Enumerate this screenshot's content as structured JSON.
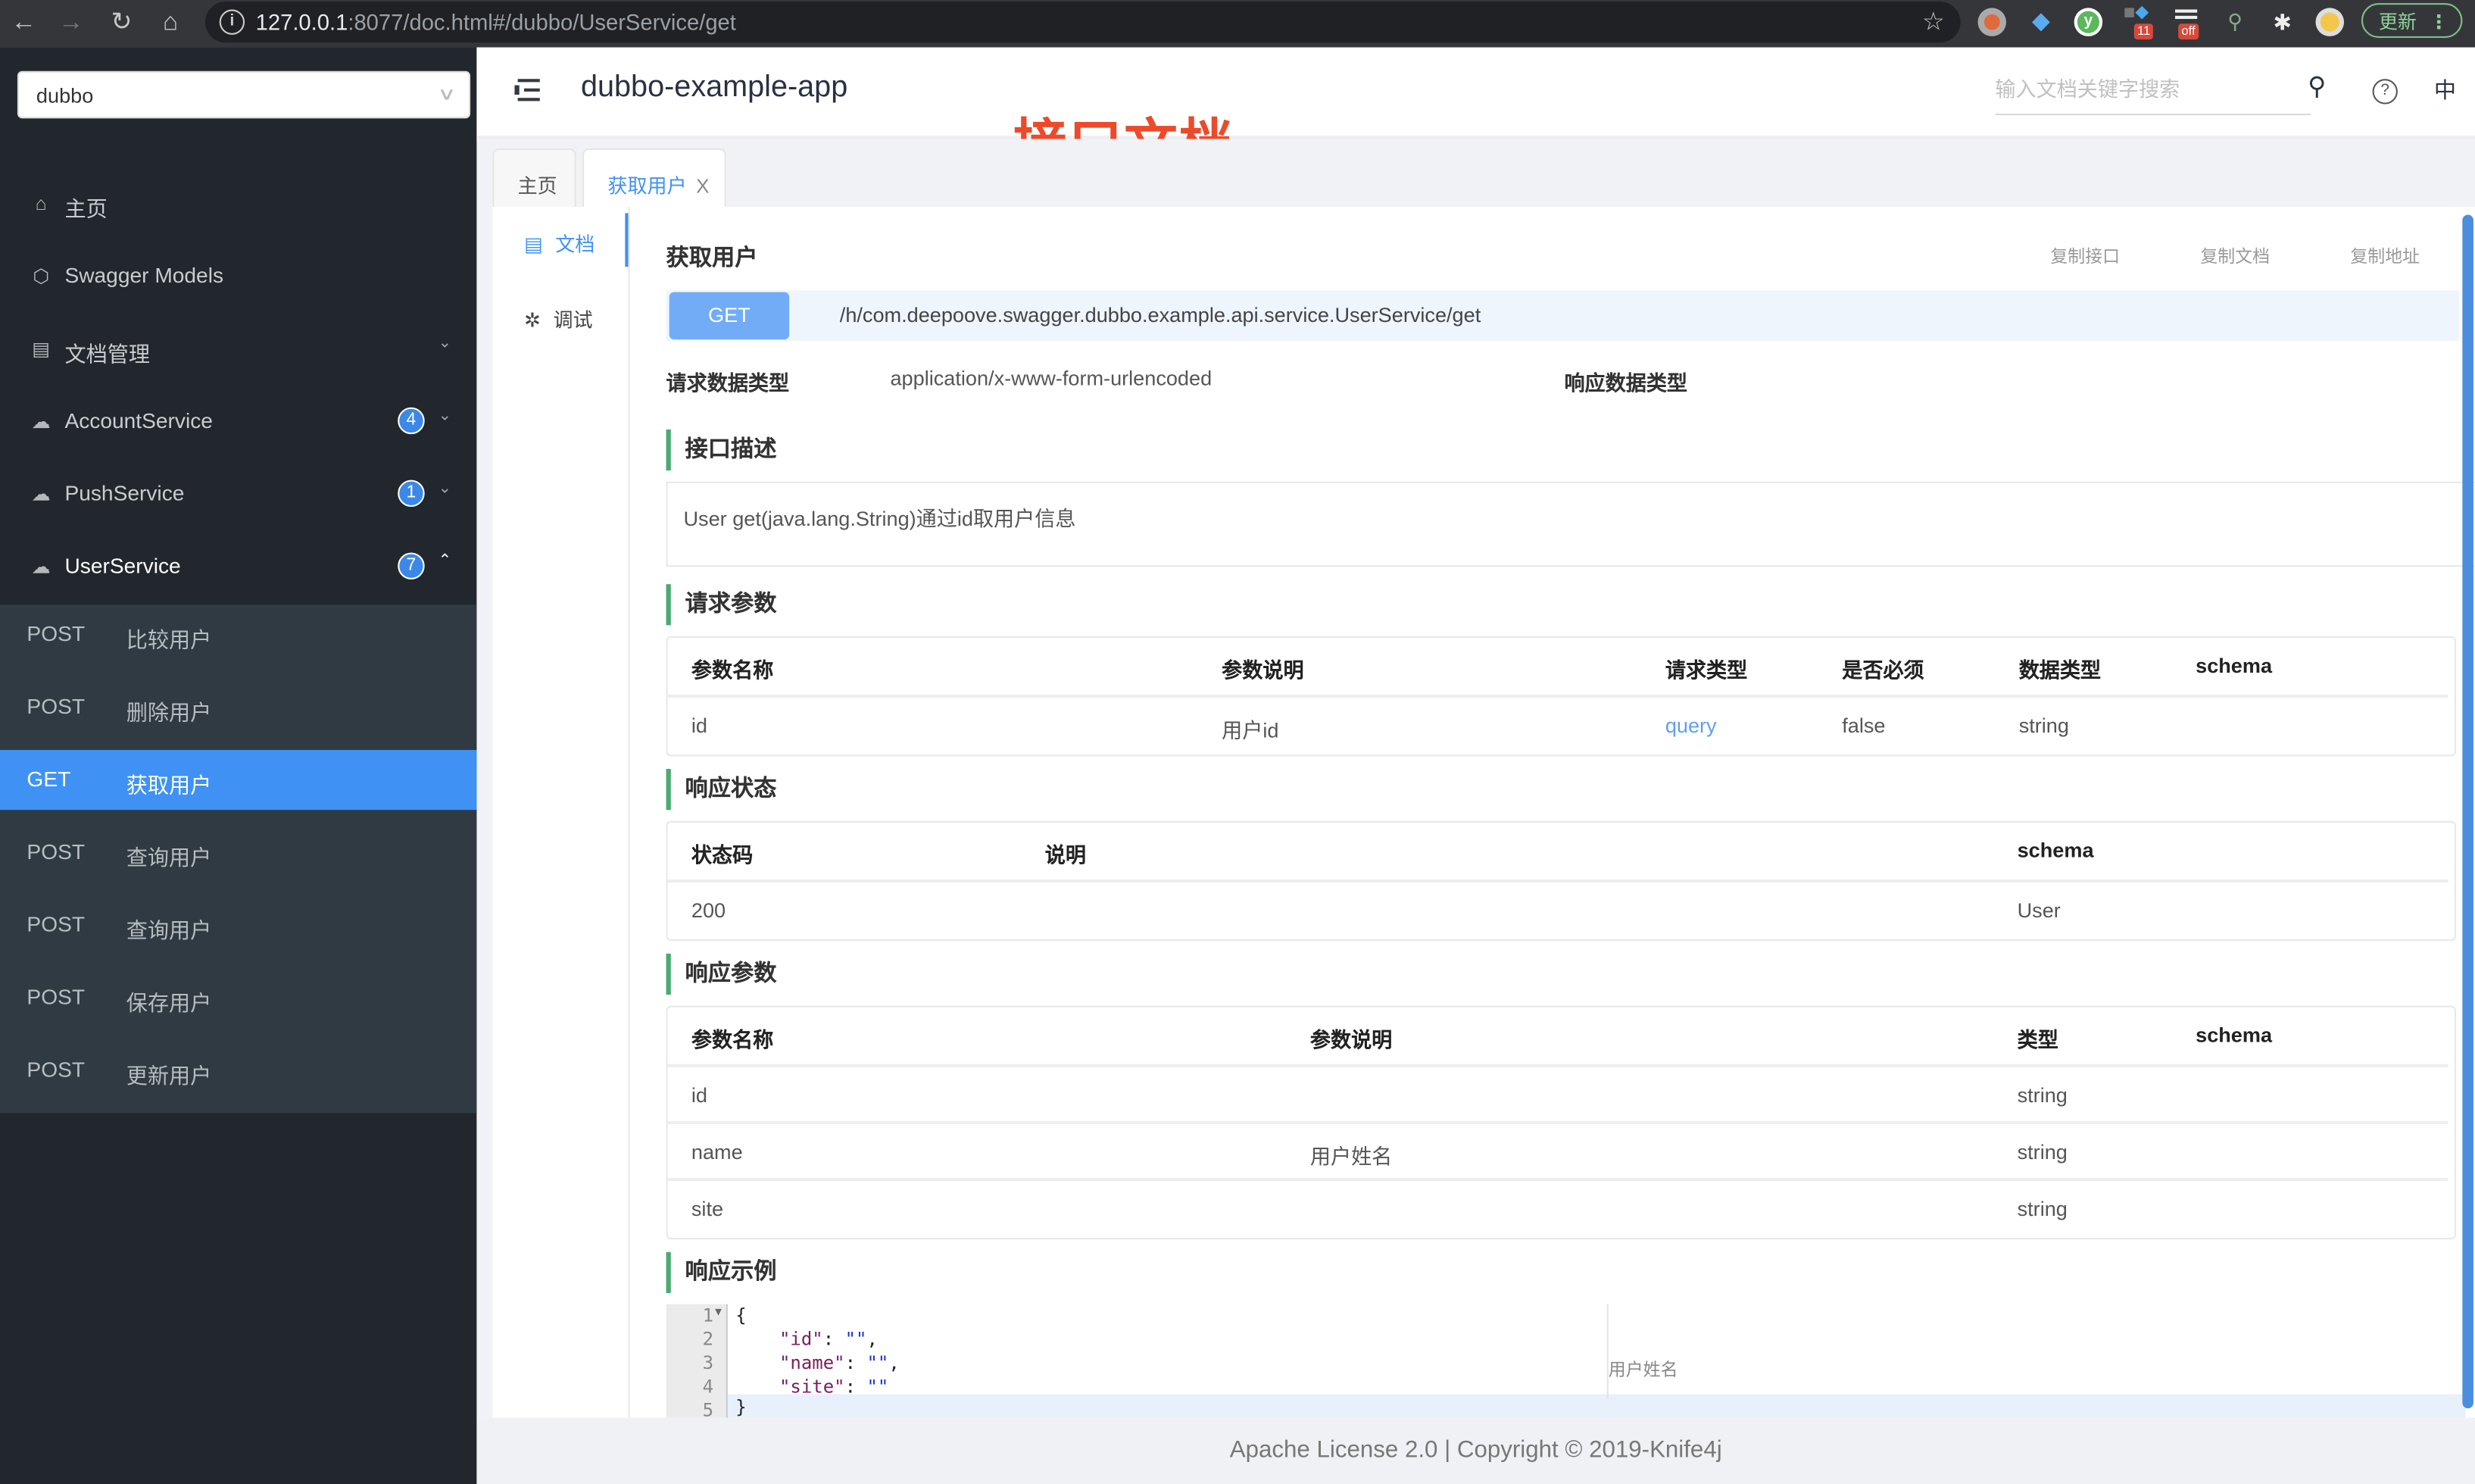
{
  "browser": {
    "url_host": "127.0.0.1",
    "url_rest": ":8077/doc.html#/dubbo/UserService/get",
    "extension_badges": [
      "11",
      "off"
    ],
    "update_label": "更新"
  },
  "sidebar": {
    "project_select": "dubbo",
    "items": [
      {
        "label": "主页",
        "icon": "home-icon"
      },
      {
        "label": "Swagger Models",
        "icon": "models-icon"
      },
      {
        "label": "文档管理",
        "icon": "doc-settings-icon",
        "expandable": true
      },
      {
        "label": "AccountService",
        "icon": "api-cloud-icon",
        "count": "4",
        "expanded": false
      },
      {
        "label": "PushService",
        "icon": "api-cloud-icon",
        "count": "1",
        "expanded": false
      },
      {
        "label": "UserService",
        "icon": "api-cloud-icon",
        "count": "7",
        "expanded": true
      }
    ],
    "operations": [
      {
        "method": "POST",
        "title": "比较用户"
      },
      {
        "method": "POST",
        "title": "删除用户"
      },
      {
        "method": "GET",
        "title": "获取用户",
        "active": true
      },
      {
        "method": "POST",
        "title": "查询用户"
      },
      {
        "method": "POST",
        "title": "查询用户"
      },
      {
        "method": "POST",
        "title": "保存用户"
      },
      {
        "method": "POST",
        "title": "更新用户"
      }
    ]
  },
  "header": {
    "app_title": "dubbo-example-app",
    "annotation": "接口文档",
    "search_placeholder": "输入文档关键字搜索",
    "lang": "中"
  },
  "tabs": [
    {
      "label": "主页",
      "active": false
    },
    {
      "label": "获取用户",
      "active": true,
      "closable": true,
      "close": "X"
    }
  ],
  "vtabs": [
    {
      "label": "文档",
      "active": true
    },
    {
      "label": "调试",
      "active": false
    }
  ],
  "doc": {
    "title": "获取用户",
    "copy_actions": [
      "复制接口",
      "复制文档",
      "复制地址"
    ],
    "method": "GET",
    "path": "/h/com.deepoove.swagger.dubbo.example.api.service.UserService/get",
    "request_type_label": "请求数据类型",
    "request_type_value": "application/x-www-form-urlencoded",
    "response_type_label": "响应数据类型",
    "response_type_value": "",
    "sections": {
      "description": "接口描述",
      "request_params": "请求参数",
      "response_status": "响应状态",
      "response_params": "响应参数",
      "response_example": "响应示例"
    },
    "description_text": "User get(java.lang.String)通过id取用户信息",
    "request_params": {
      "headers": [
        "参数名称",
        "参数说明",
        "请求类型",
        "是否必须",
        "数据类型",
        "schema"
      ],
      "rows": [
        [
          "id",
          "用户id",
          "query",
          "false",
          "string",
          ""
        ]
      ]
    },
    "response_status": {
      "headers": [
        "状态码",
        "说明",
        "schema"
      ],
      "rows": [
        [
          "200",
          "",
          "User"
        ]
      ]
    },
    "response_params": {
      "headers": [
        "参数名称",
        "参数说明",
        "类型",
        "schema"
      ],
      "rows": [
        [
          "id",
          "",
          "string",
          ""
        ],
        [
          "name",
          "用户姓名",
          "string",
          ""
        ],
        [
          "site",
          "",
          "string",
          ""
        ]
      ]
    },
    "example": {
      "line_numbers": [
        "1",
        "2",
        "3",
        "4",
        "5"
      ],
      "lines": [
        {
          "text": "{"
        },
        {
          "key": "\"id\"",
          "sep": ": ",
          "val": "\"\"",
          "end": ","
        },
        {
          "key": "\"name\"",
          "sep": ": ",
          "val": "\"\"",
          "end": ","
        },
        {
          "key": "\"site\"",
          "sep": ": ",
          "val": "\"\"",
          "end": ""
        },
        {
          "text": "}"
        }
      ],
      "side_note": "用户姓名"
    }
  },
  "footer": "Apache License 2.0 | Copyright © 2019-Knife4j"
}
